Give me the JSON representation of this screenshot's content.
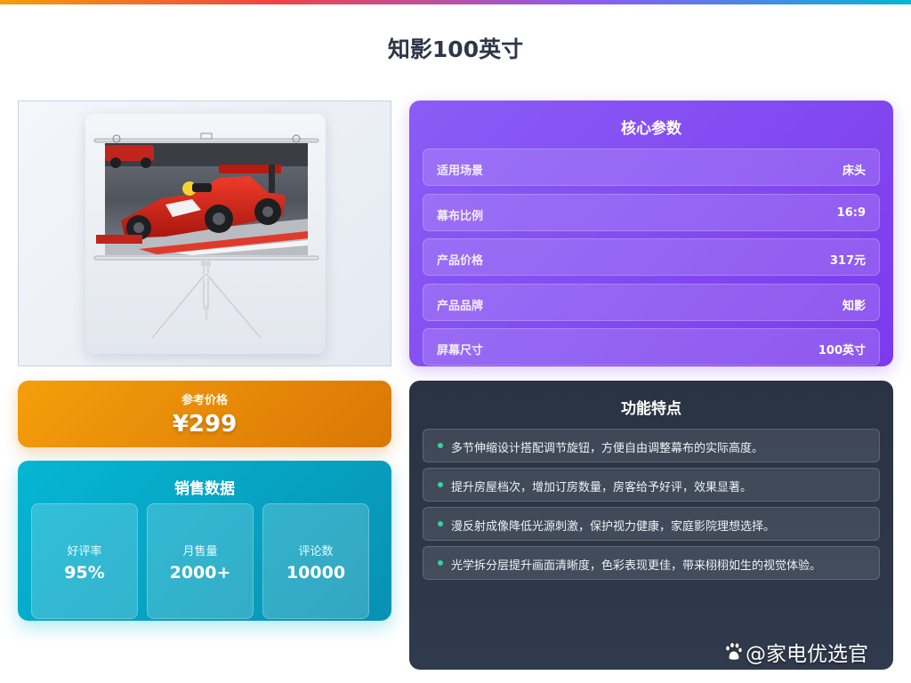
{
  "page": {
    "title": "知影100英寸"
  },
  "colors": {
    "specs_accent": "#7c3aed",
    "price_accent": "#d97706",
    "sales_accent": "#06b6d4",
    "features_bg": "#2d3748",
    "feature_bullet": "#34d399"
  },
  "price": {
    "label": "参考价格",
    "value": "¥299"
  },
  "sales": {
    "title": "销售数据",
    "stats": [
      {
        "label": "好评率",
        "value": "95%"
      },
      {
        "label": "月售量",
        "value": "2000+"
      },
      {
        "label": "评论数",
        "value": "10000"
      }
    ]
  },
  "specs": {
    "title": "核心参数",
    "rows": [
      {
        "name": "适用场景",
        "value": "床头"
      },
      {
        "name": "幕布比例",
        "value": "16:9"
      },
      {
        "name": "产品价格",
        "value": "317元"
      },
      {
        "name": "产品品牌",
        "value": "知影"
      },
      {
        "name": "屏幕尺寸",
        "value": "100英寸"
      }
    ]
  },
  "features": {
    "title": "功能特点",
    "items": [
      "多节伸缩设计搭配调节旋钮，方便自由调整幕布的实际高度。",
      "提升房屋档次，增加订房数量，房客给予好评，效果显著。",
      "漫反射成像降低光源刺激，保护视力健康，家庭影院理想选择。",
      "光学拆分层提升画面清晰度，色彩表现更佳，带来栩栩如生的视觉体验。"
    ]
  },
  "watermark": {
    "text": "@家电优选官"
  }
}
